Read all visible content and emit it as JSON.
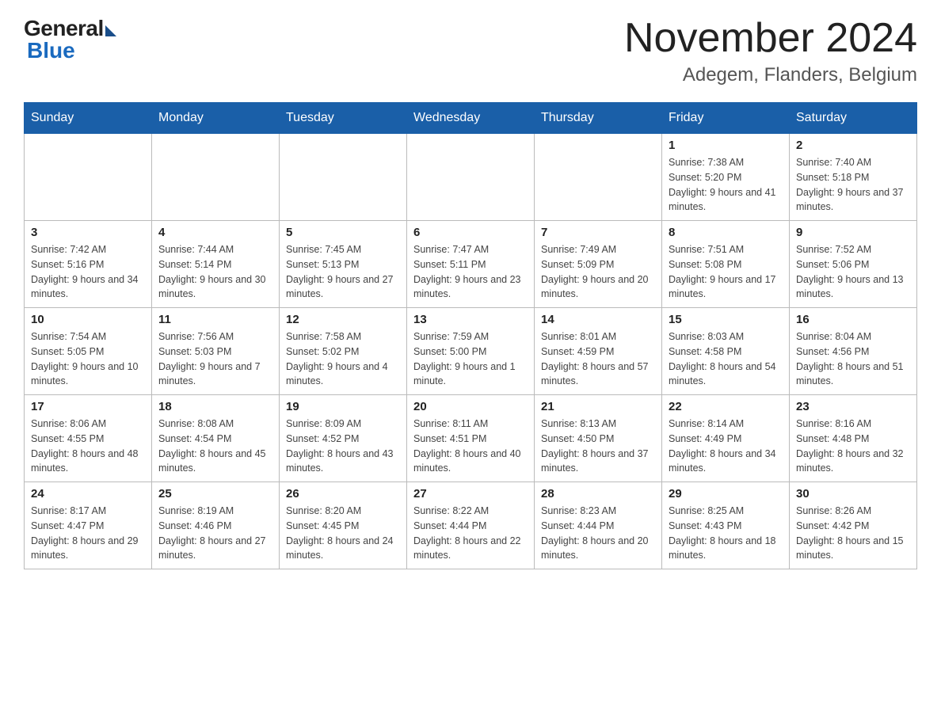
{
  "header": {
    "logo_general": "General",
    "logo_blue": "Blue",
    "month_title": "November 2024",
    "location": "Adegem, Flanders, Belgium"
  },
  "weekdays": [
    "Sunday",
    "Monday",
    "Tuesday",
    "Wednesday",
    "Thursday",
    "Friday",
    "Saturday"
  ],
  "weeks": [
    [
      {
        "day": "",
        "info": ""
      },
      {
        "day": "",
        "info": ""
      },
      {
        "day": "",
        "info": ""
      },
      {
        "day": "",
        "info": ""
      },
      {
        "day": "",
        "info": ""
      },
      {
        "day": "1",
        "info": "Sunrise: 7:38 AM\nSunset: 5:20 PM\nDaylight: 9 hours and 41 minutes."
      },
      {
        "day": "2",
        "info": "Sunrise: 7:40 AM\nSunset: 5:18 PM\nDaylight: 9 hours and 37 minutes."
      }
    ],
    [
      {
        "day": "3",
        "info": "Sunrise: 7:42 AM\nSunset: 5:16 PM\nDaylight: 9 hours and 34 minutes."
      },
      {
        "day": "4",
        "info": "Sunrise: 7:44 AM\nSunset: 5:14 PM\nDaylight: 9 hours and 30 minutes."
      },
      {
        "day": "5",
        "info": "Sunrise: 7:45 AM\nSunset: 5:13 PM\nDaylight: 9 hours and 27 minutes."
      },
      {
        "day": "6",
        "info": "Sunrise: 7:47 AM\nSunset: 5:11 PM\nDaylight: 9 hours and 23 minutes."
      },
      {
        "day": "7",
        "info": "Sunrise: 7:49 AM\nSunset: 5:09 PM\nDaylight: 9 hours and 20 minutes."
      },
      {
        "day": "8",
        "info": "Sunrise: 7:51 AM\nSunset: 5:08 PM\nDaylight: 9 hours and 17 minutes."
      },
      {
        "day": "9",
        "info": "Sunrise: 7:52 AM\nSunset: 5:06 PM\nDaylight: 9 hours and 13 minutes."
      }
    ],
    [
      {
        "day": "10",
        "info": "Sunrise: 7:54 AM\nSunset: 5:05 PM\nDaylight: 9 hours and 10 minutes."
      },
      {
        "day": "11",
        "info": "Sunrise: 7:56 AM\nSunset: 5:03 PM\nDaylight: 9 hours and 7 minutes."
      },
      {
        "day": "12",
        "info": "Sunrise: 7:58 AM\nSunset: 5:02 PM\nDaylight: 9 hours and 4 minutes."
      },
      {
        "day": "13",
        "info": "Sunrise: 7:59 AM\nSunset: 5:00 PM\nDaylight: 9 hours and 1 minute."
      },
      {
        "day": "14",
        "info": "Sunrise: 8:01 AM\nSunset: 4:59 PM\nDaylight: 8 hours and 57 minutes."
      },
      {
        "day": "15",
        "info": "Sunrise: 8:03 AM\nSunset: 4:58 PM\nDaylight: 8 hours and 54 minutes."
      },
      {
        "day": "16",
        "info": "Sunrise: 8:04 AM\nSunset: 4:56 PM\nDaylight: 8 hours and 51 minutes."
      }
    ],
    [
      {
        "day": "17",
        "info": "Sunrise: 8:06 AM\nSunset: 4:55 PM\nDaylight: 8 hours and 48 minutes."
      },
      {
        "day": "18",
        "info": "Sunrise: 8:08 AM\nSunset: 4:54 PM\nDaylight: 8 hours and 45 minutes."
      },
      {
        "day": "19",
        "info": "Sunrise: 8:09 AM\nSunset: 4:52 PM\nDaylight: 8 hours and 43 minutes."
      },
      {
        "day": "20",
        "info": "Sunrise: 8:11 AM\nSunset: 4:51 PM\nDaylight: 8 hours and 40 minutes."
      },
      {
        "day": "21",
        "info": "Sunrise: 8:13 AM\nSunset: 4:50 PM\nDaylight: 8 hours and 37 minutes."
      },
      {
        "day": "22",
        "info": "Sunrise: 8:14 AM\nSunset: 4:49 PM\nDaylight: 8 hours and 34 minutes."
      },
      {
        "day": "23",
        "info": "Sunrise: 8:16 AM\nSunset: 4:48 PM\nDaylight: 8 hours and 32 minutes."
      }
    ],
    [
      {
        "day": "24",
        "info": "Sunrise: 8:17 AM\nSunset: 4:47 PM\nDaylight: 8 hours and 29 minutes."
      },
      {
        "day": "25",
        "info": "Sunrise: 8:19 AM\nSunset: 4:46 PM\nDaylight: 8 hours and 27 minutes."
      },
      {
        "day": "26",
        "info": "Sunrise: 8:20 AM\nSunset: 4:45 PM\nDaylight: 8 hours and 24 minutes."
      },
      {
        "day": "27",
        "info": "Sunrise: 8:22 AM\nSunset: 4:44 PM\nDaylight: 8 hours and 22 minutes."
      },
      {
        "day": "28",
        "info": "Sunrise: 8:23 AM\nSunset: 4:44 PM\nDaylight: 8 hours and 20 minutes."
      },
      {
        "day": "29",
        "info": "Sunrise: 8:25 AM\nSunset: 4:43 PM\nDaylight: 8 hours and 18 minutes."
      },
      {
        "day": "30",
        "info": "Sunrise: 8:26 AM\nSunset: 4:42 PM\nDaylight: 8 hours and 15 minutes."
      }
    ]
  ]
}
